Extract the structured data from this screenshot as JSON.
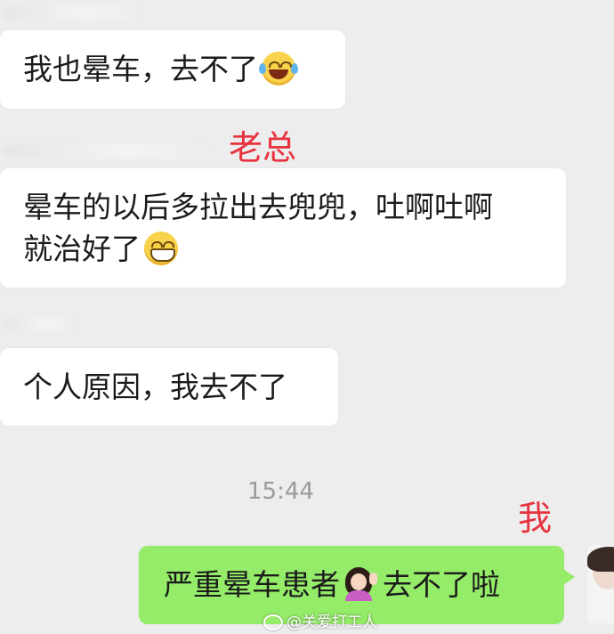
{
  "messages": [
    {
      "text": "我也晕车，去不了",
      "emoji": "laughing-tears-emoji"
    },
    {
      "line1": "晕车的以后多拉出去兜兜，吐啊吐啊",
      "line2": "就治好了",
      "emoji": "grinning-emoji"
    },
    {
      "text": "个人原因，我去不了"
    }
  ],
  "timestamp": "15:44",
  "annotations": {
    "boss": "老总",
    "me": "我"
  },
  "self_message": {
    "part1": "严重晕车患者",
    "emoji": "person-raising-hand-emoji",
    "part2": "去不了啦"
  },
  "watermark": "@关爱打工人",
  "colors": {
    "background": "#ededed",
    "bubble": "#ffffff",
    "self_bubble": "#95ec69",
    "annotation": "#e8323e",
    "timestamp": "#9b9b9b"
  }
}
